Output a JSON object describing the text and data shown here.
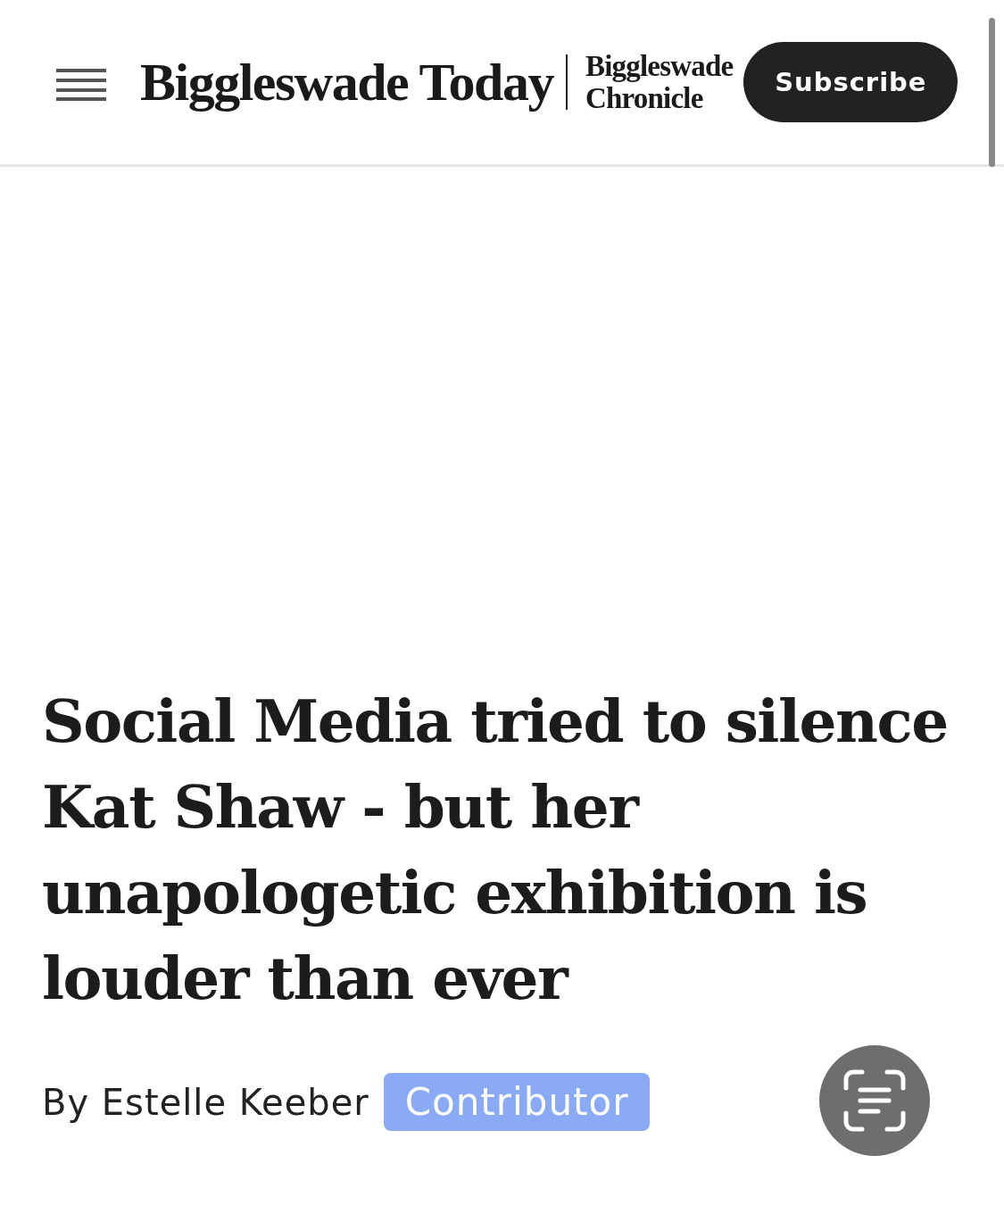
{
  "header": {
    "logo": "Biggleswade Today",
    "sub_logo": [
      "Biggleswade",
      "Chronicle"
    ],
    "subscribe_button": "Subscribe"
  },
  "article": {
    "headline": "Social Media tried to silence\nKat Shaw - but her\nunapologetic exhibition is\nlouder than ever",
    "byline": "By Estelle Keeber",
    "role_badge": "Contributor"
  }
}
